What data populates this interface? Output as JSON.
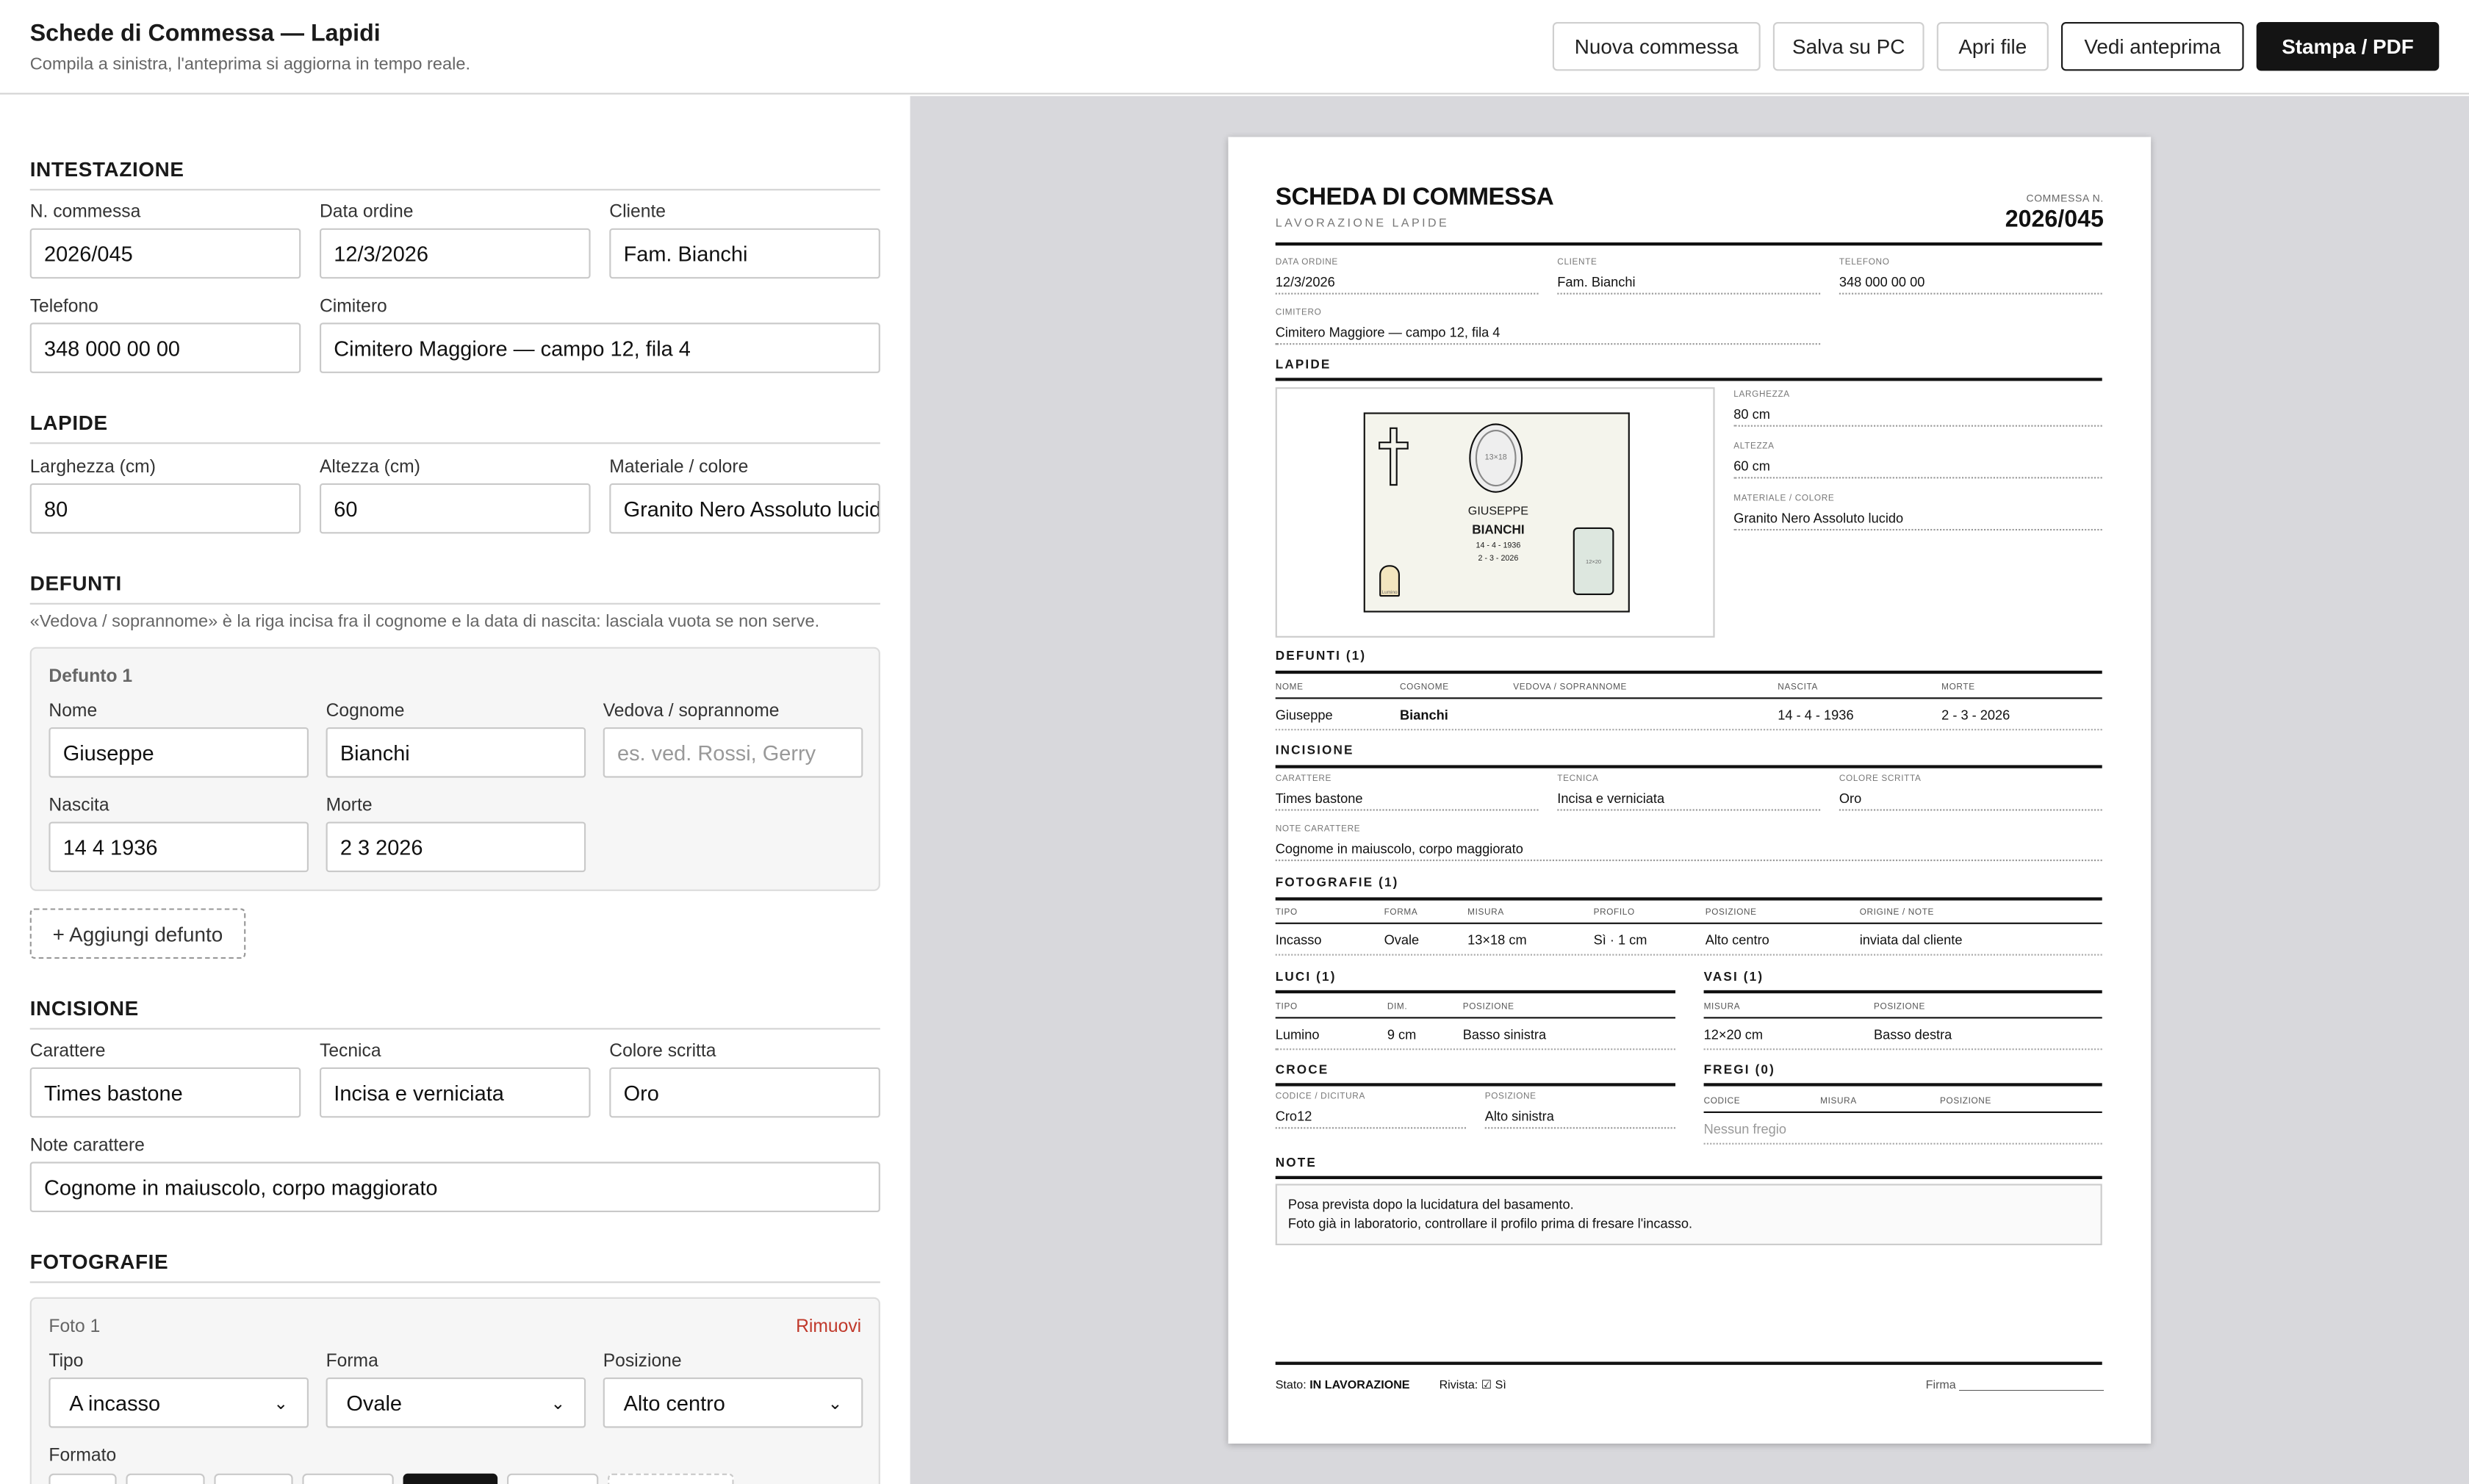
{
  "app": {
    "title": "Schede di Commessa — Lapidi",
    "subtitle": "Compila a sinistra, l'anteprima si aggiorna in tempo reale."
  },
  "toolbar": {
    "new": "Nuova commessa",
    "save": "Salva su PC",
    "open": "Apri file",
    "preview": "Vedi anteprima",
    "print": "Stampa / PDF"
  },
  "form": {
    "intestazione": {
      "title": "INTESTAZIONE",
      "numero_label": "N. commessa",
      "numero": "2026/045",
      "data_label": "Data ordine",
      "data": "12/3/2026",
      "cliente_label": "Cliente",
      "cliente": "Fam. Bianchi",
      "telefono_label": "Telefono",
      "telefono": "348 000 00 00",
      "cimitero_label": "Cimitero",
      "cimitero": "Cimitero Maggiore — campo 12, fila 4"
    },
    "lapide": {
      "title": "LAPIDE",
      "larghezza_label": "Larghezza (cm)",
      "larghezza": "80",
      "altezza_label": "Altezza (cm)",
      "altezza": "60",
      "materiale_label": "Materiale / colore",
      "materiale": "Granito Nero Assoluto lucido"
    },
    "defunti": {
      "title": "DEFUNTI",
      "hint": "«Vedova / soprannome» è la riga incisa fra il cognome e la data di nascita: lasciala vuota se non serve.",
      "card_title": "Defunto 1",
      "nome_label": "Nome",
      "nome": "Giuseppe",
      "cognome_label": "Cognome",
      "cognome": "Bianchi",
      "vedova_label": "Vedova / soprannome",
      "vedova_placeholder": "es. ved. Rossi, Gerry",
      "nascita_label": "Nascita",
      "nascita": "14 4 1936",
      "morte_label": "Morte",
      "morte": "2 3 2026",
      "add": "+ Aggiungi defunto"
    },
    "incisione": {
      "title": "INCISIONE",
      "carattere_label": "Carattere",
      "carattere": "Times bastone",
      "tecnica_label": "Tecnica",
      "tecnica": "Incisa e verniciata",
      "colore_label": "Colore scritta",
      "colore": "Oro",
      "note_label": "Note carattere",
      "note": "Cognome in maiuscolo, corpo maggiorato"
    },
    "fotografie": {
      "title": "FOTOGRAFIE",
      "card_title": "Foto 1",
      "remove": "Rimuovi",
      "tipo_label": "Tipo",
      "tipo": "A incasso",
      "forma_label": "Forma",
      "forma": "Ovale",
      "posizione_label": "Posizione",
      "posizione": "Alto centro",
      "formato_label": "Formato"
    }
  },
  "sheet": {
    "title": "SCHEDA DI COMMESSA",
    "subtitle": "LAVORAZIONE LAPIDE",
    "commessa_label": "COMMESSA N.",
    "commessa": "2026/045",
    "data_label": "DATA ORDINE",
    "data": "12/3/2026",
    "cliente_label": "CLIENTE",
    "cliente": "Fam. Bianchi",
    "telefono_label": "TELEFONO",
    "telefono": "348 000 00 00",
    "cimitero_label": "CIMITERO",
    "cimitero": "Cimitero Maggiore — campo 12, fila 4",
    "lapide_title": "LAPIDE",
    "drawing": {
      "photo": "13×18",
      "name": "GIUSEPPE",
      "surname": "BIANCHI",
      "born": "14 - 4 - 1936",
      "died": "2 - 3 - 2026",
      "vase": "12×20",
      "lamp": "Lumino"
    },
    "larghezza_label": "LARGHEZZA",
    "larghezza": "80 cm",
    "altezza_label": "ALTEZZA",
    "altezza": "60 cm",
    "materiale_label": "MATERIALE / COLORE",
    "materiale": "Granito Nero Assoluto lucido",
    "defunti_title": "DEFUNTI (1)",
    "defunti_headers": [
      "NOME",
      "COGNOME",
      "VEDOVA / SOPRANNOME",
      "NASCITA",
      "MORTE"
    ],
    "defunti_row": [
      "Giuseppe",
      "Bianchi",
      "",
      "14 - 4 - 1936",
      "2 - 3 - 2026"
    ],
    "incisione_title": "INCISIONE",
    "carattere_label": "CARATTERE",
    "carattere": "Times bastone",
    "tecnica_label": "TECNICA",
    "tecnica": "Incisa e verniciata",
    "colore_label": "COLORE SCRITTA",
    "colore": "Oro",
    "note_car_label": "NOTE CARATTERE",
    "note_car": "Cognome in maiuscolo, corpo maggiorato",
    "foto_title": "FOTOGRAFIE (1)",
    "foto_headers": [
      "TIPO",
      "FORMA",
      "MISURA",
      "PROFILO",
      "POSIZIONE",
      "ORIGINE / NOTE"
    ],
    "foto_row": [
      "Incasso",
      "Ovale",
      "13×18 cm",
      "Sì · 1 cm",
      "Alto centro",
      "inviata dal cliente"
    ],
    "luci_title": "LUCI (1)",
    "luci_headers": [
      "TIPO",
      "DIM.",
      "POSIZIONE"
    ],
    "luci_row": [
      "Lumino",
      "9 cm",
      "Basso sinistra"
    ],
    "vasi_title": "VASI (1)",
    "vasi_headers": [
      "MISURA",
      "POSIZIONE"
    ],
    "vasi_row": [
      "12×20 cm",
      "Basso destra"
    ],
    "croce_title": "CROCE",
    "croce_code_label": "CODICE / DICITURA",
    "croce_code": "Cro12",
    "croce_pos_label": "POSIZIONE",
    "croce_pos": "Alto sinistra",
    "fregi_title": "FREGI (0)",
    "fregi_headers": [
      "CODICE",
      "MISURA",
      "POSIZIONE"
    ],
    "fregi_empty": "Nessun fregio",
    "note_title": "NOTE",
    "note_lines": [
      "Posa prevista dopo la lucidatura del basamento.",
      "Foto già in laboratorio, controllare il profilo prima di fresare l'incasso."
    ],
    "stato_label": "Stato:",
    "stato": "IN LAVORAZIONE",
    "rivista": "Rivista: ☑ Sì",
    "firma": "Firma ______________________"
  },
  "colors": {
    "accent_dark": "#141414",
    "remove_red": "#c0392b",
    "preview_bg": "#d8d8dc"
  }
}
